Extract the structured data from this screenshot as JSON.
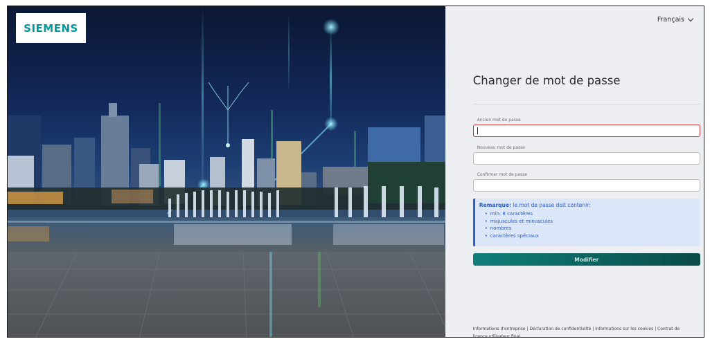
{
  "brand": {
    "logo_text": "SIEMENS",
    "accent": "#009999"
  },
  "header": {
    "language": "Français"
  },
  "form": {
    "title": "Changer de mot de passe",
    "old_password": {
      "label": "Ancien mot de passe",
      "value": ""
    },
    "new_password": {
      "label": "Nouveau mot de passe",
      "value": ""
    },
    "confirm_password": {
      "label": "Confirmer mot de passe",
      "value": ""
    },
    "submit_label": "Modifier"
  },
  "note": {
    "title": "Remarque:",
    "text": "le mot de passe doit contenir:",
    "rules": [
      "min. 8 caractères",
      "majuscules et minuscules",
      "nombres",
      "caractères spéciaux"
    ]
  },
  "footer": {
    "links": [
      "Informations d'entreprise",
      "Déclaration de confidentialité",
      "Informations sur les cookies",
      "Contrat de licence utilisateur final"
    ]
  },
  "colors": {
    "error_border": "#d72f3a",
    "note_blue": "#2d5ccc",
    "button_teal": "#0b5f5c"
  }
}
